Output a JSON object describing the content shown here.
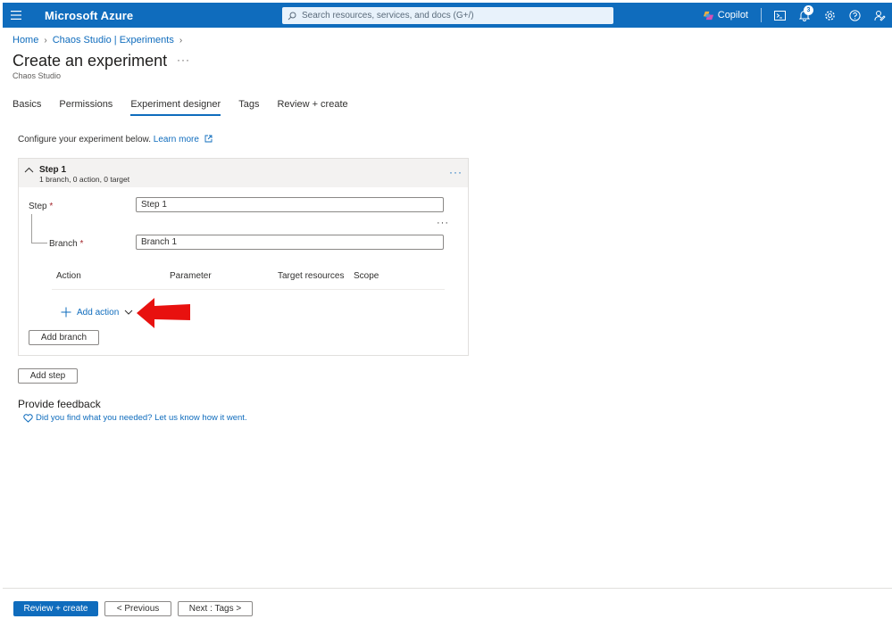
{
  "topbar": {
    "brand": "Microsoft Azure",
    "search_placeholder": "Search resources, services, and docs (G+/)",
    "copilot_label": "Copilot",
    "notification_count": "3"
  },
  "breadcrumb": {
    "items": [
      "Home",
      "Chaos Studio | Experiments"
    ]
  },
  "page": {
    "title": "Create an experiment",
    "more": "···",
    "subtitle": "Chaos Studio"
  },
  "tabs": [
    {
      "label": "Basics"
    },
    {
      "label": "Permissions"
    },
    {
      "label": "Experiment designer",
      "active": true
    },
    {
      "label": "Tags"
    },
    {
      "label": "Review + create"
    }
  ],
  "config": {
    "text": "Configure your experiment below.",
    "link": "Learn more"
  },
  "step": {
    "title": "Step 1",
    "summary": "1 branch, 0 action, 0 target",
    "more": "···",
    "step_label": "Step",
    "step_value": "Step 1",
    "branch_label": "Branch",
    "branch_value": "Branch 1",
    "required_mark": "*",
    "branch_more": "···",
    "columns": [
      "Action",
      "Parameter",
      "Target resources",
      "Scope"
    ],
    "add_action_label": "Add action",
    "add_branch_label": "Add branch"
  },
  "add_step_label": "Add step",
  "feedback": {
    "title": "Provide feedback",
    "link": "Did you find what you needed? Let us know how it went."
  },
  "footer": {
    "review_create": "Review + create",
    "previous": "< Previous",
    "next": "Next : Tags >"
  },
  "colors": {
    "azure_blue": "#0f6cbd",
    "required_red": "#a4262c",
    "arrow_red": "#e8110f"
  }
}
